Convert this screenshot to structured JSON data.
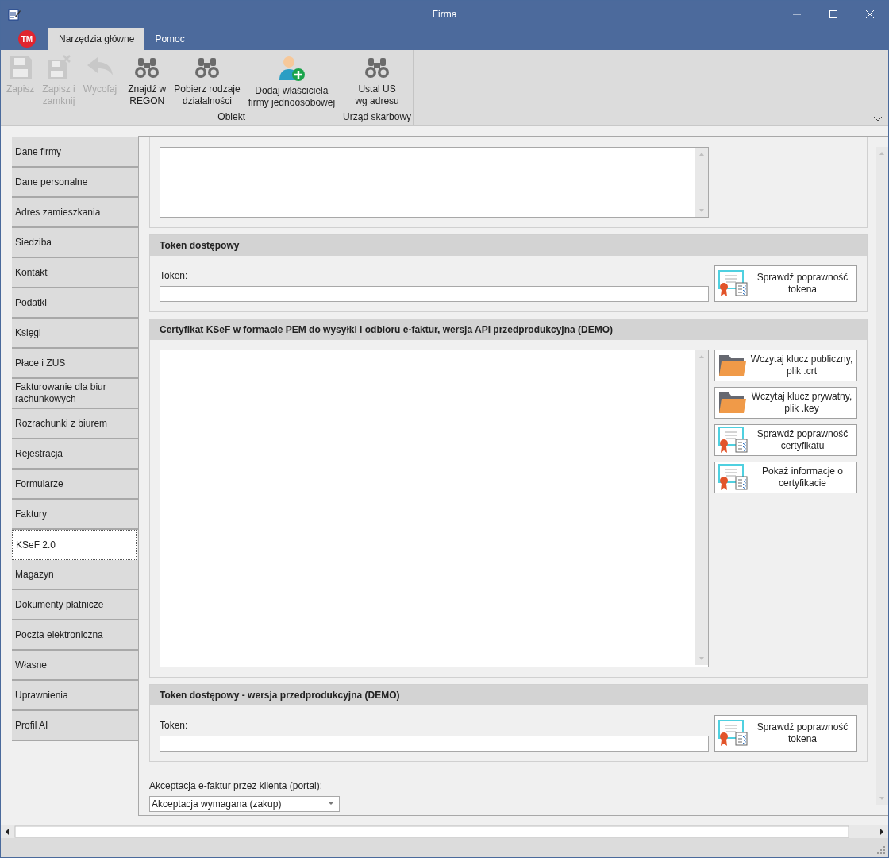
{
  "window": {
    "title": "Firma"
  },
  "app_badge": "TM",
  "ribbon_tabs": [
    {
      "label": "Narzędzia główne",
      "selected": true
    },
    {
      "label": "Pomoc",
      "selected": false
    }
  ],
  "ribbon_groups": [
    {
      "buttons": [
        {
          "label": "Zapisz",
          "kind": "save",
          "disabled": true
        },
        {
          "label": "Zapisz i\nzamknij",
          "kind": "save-close",
          "disabled": true
        },
        {
          "label": "Wycofaj",
          "kind": "undo",
          "disabled": true
        }
      ]
    },
    {
      "caption": "Obiekt",
      "buttons": [
        {
          "label": "Znajdź w\nREGON",
          "kind": "binoculars",
          "disabled": false
        },
        {
          "label": "Pobierz rodzaje\ndziałalności",
          "kind": "binoculars",
          "disabled": false
        },
        {
          "label": "Dodaj właściciela\nfirmy jednoosobowej",
          "kind": "person-add",
          "disabled": false
        }
      ]
    },
    {
      "caption": "Urząd skarbowy",
      "buttons": [
        {
          "label": "Ustal US\nwg adresu",
          "kind": "binoculars",
          "disabled": false
        }
      ]
    }
  ],
  "sidebar": {
    "items": [
      {
        "label": "Dane firmy",
        "selected": false
      },
      {
        "label": "Dane personalne",
        "selected": false
      },
      {
        "label": "Adres zamieszkania",
        "selected": false
      },
      {
        "label": "Siedziba",
        "selected": false
      },
      {
        "label": "Kontakt",
        "selected": false
      },
      {
        "label": "Podatki",
        "selected": false
      },
      {
        "label": "Księgi",
        "selected": false
      },
      {
        "label": "Płace i ZUS",
        "selected": false
      },
      {
        "label": "Fakturowanie dla biur rachunkowych",
        "selected": false
      },
      {
        "label": "Rozrachunki z biurem",
        "selected": false
      },
      {
        "label": "Rejestracja",
        "selected": false
      },
      {
        "label": "Formularze",
        "selected": false
      },
      {
        "label": "Faktury",
        "selected": false
      },
      {
        "label": "KSeF 2.0",
        "selected": true
      },
      {
        "label": "Magazyn",
        "selected": false
      },
      {
        "label": "Dokumenty płatnicze",
        "selected": false
      },
      {
        "label": "Poczta elektroniczna",
        "selected": false
      },
      {
        "label": "Własne",
        "selected": false
      },
      {
        "label": "Uprawnienia",
        "selected": false
      },
      {
        "label": "Profil AI",
        "selected": false
      }
    ]
  },
  "sections": [
    {
      "kind": "token",
      "title": "Token dostępowy",
      "field_label": "Token:",
      "buttons": [
        {
          "label": "Sprawdź poprawność\ntokena",
          "kind": "cert"
        }
      ]
    },
    {
      "kind": "certificate",
      "title": "Certyfikat KSeF w formacie PEM do wysyłki i odbioru e-faktur, wersja API przedprodukcyjna (DEMO)",
      "buttons": [
        {
          "label": "Wczytaj klucz publiczny,\nplik .crt",
          "kind": "folder"
        },
        {
          "label": "Wczytaj klucz prywatny,\nplik .key",
          "kind": "folder"
        },
        {
          "label": "Sprawdź poprawność\ncertyfikatu",
          "kind": "cert"
        },
        {
          "label": "Pokaż informacje o\ncertyfikacie",
          "kind": "cert"
        }
      ]
    },
    {
      "kind": "token",
      "title": "Token dostępowy - wersja przedprodukcyjna (DEMO)",
      "field_label": "Token:",
      "buttons": [
        {
          "label": "Sprawdź poprawność\ntokena",
          "kind": "cert"
        }
      ]
    }
  ],
  "acceptance": {
    "label": "Akceptacja e-faktur przez klienta (portal):",
    "value": "Akceptacja wymagana (zakup)"
  }
}
